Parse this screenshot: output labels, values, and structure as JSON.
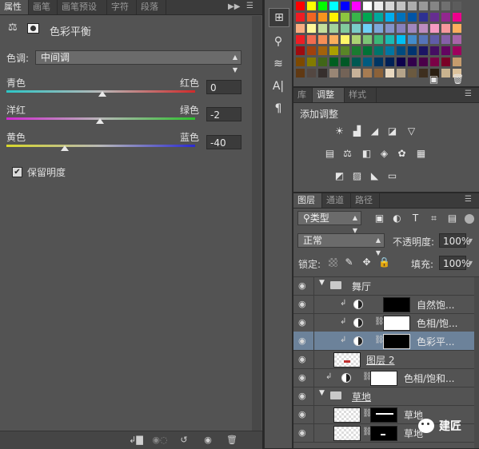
{
  "properties_panel": {
    "tabs": [
      "属性",
      "画笔",
      "画笔预设",
      "字符",
      "段落"
    ],
    "title": "色彩平衡",
    "tone_label": "色调:",
    "tone_value": "中间调",
    "sliders": [
      {
        "left_label": "青色",
        "right_label": "红色",
        "value": "0",
        "position": 0.5
      },
      {
        "left_label": "洋红",
        "right_label": "绿色",
        "value": "-2",
        "position": 0.49
      },
      {
        "left_label": "黄色",
        "right_label": "蓝色",
        "value": "-40",
        "position": 0.31
      }
    ],
    "preserve_luminosity_label": "保留明度",
    "preserve_luminosity_checked": true
  },
  "adjustments_panel": {
    "tabs": [
      "库",
      "调整",
      "样式"
    ],
    "title": "添加调整"
  },
  "layers_panel": {
    "tabs": [
      "图层",
      "通道",
      "路径"
    ],
    "filter_label": "类型",
    "blend_mode": "正常",
    "opacity_label": "不透明度:",
    "opacity_value": "100%",
    "lock_label": "锁定:",
    "fill_label": "填充:",
    "fill_value": "100%",
    "layers": [
      {
        "name": "舞厅",
        "kind": "group"
      },
      {
        "name": "自然饱...",
        "kind": "adjustment"
      },
      {
        "name": "色相/饱...",
        "kind": "adjustment"
      },
      {
        "name": "色彩平...",
        "kind": "adjustment",
        "selected": true
      },
      {
        "name": "图层 2",
        "kind": "pixel"
      },
      {
        "name": "色相/饱和...",
        "kind": "adjustment"
      },
      {
        "name": "草地",
        "kind": "group"
      },
      {
        "name": "草地",
        "kind": "pixel"
      },
      {
        "name": "草地",
        "kind": "pixel"
      }
    ]
  },
  "watermark": "建匠"
}
